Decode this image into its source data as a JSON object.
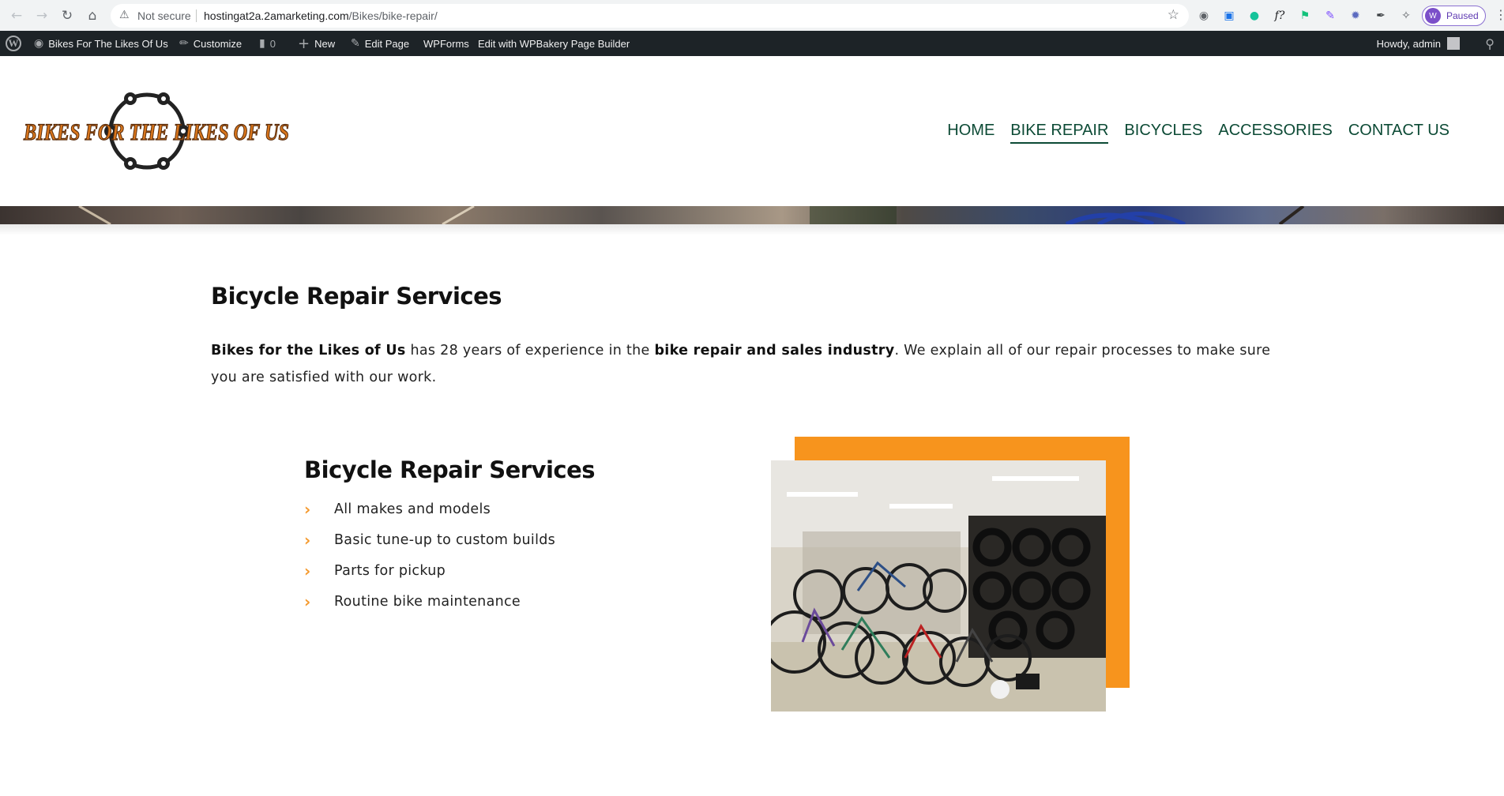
{
  "browser": {
    "security_label": "Not secure",
    "url_host": "hostingat2a.2amarketing.com",
    "url_path": "/Bikes/bike-repair/",
    "profile_initial": "W",
    "profile_status": "Paused"
  },
  "admin_bar": {
    "site_name": "Bikes For The Likes Of Us",
    "customize": "Customize",
    "comments_count": "0",
    "new": "New",
    "edit_page": "Edit Page",
    "wpforms": "WPForms",
    "wpbakery": "Edit with WPBakery Page Builder",
    "howdy": "Howdy, admin"
  },
  "logo": {
    "text": "BIKES FOR THE LIKES OF US"
  },
  "nav": {
    "items": [
      {
        "label": "HOME"
      },
      {
        "label": "BIKE REPAIR"
      },
      {
        "label": "BICYCLES"
      },
      {
        "label": "ACCESSORIES"
      },
      {
        "label": "CONTACT US"
      }
    ],
    "active_index": 1
  },
  "content": {
    "title": "Bicycle Repair Services",
    "intro": {
      "brand": "Bikes for the Likes of Us",
      "part1": " has 28 years of experience in the ",
      "highlight": "bike repair and sales industry",
      "part2": ". We explain all of our repair processes to make sure you are satisfied with our work."
    },
    "section_title": "Bicycle Repair Services",
    "services": [
      "All makes and models",
      "Basic tune-up to custom builds",
      "Parts for pickup",
      "Routine bike maintenance"
    ]
  },
  "colors": {
    "nav_green": "#0c4a35",
    "accent_orange": "#f7941d",
    "admin_bar": "#1d2327"
  },
  "icons": {
    "back": "arrow-left-icon",
    "forward": "arrow-right-icon",
    "reload": "reload-icon",
    "home": "home-icon",
    "list_bullet": "chevron-right-icon"
  }
}
